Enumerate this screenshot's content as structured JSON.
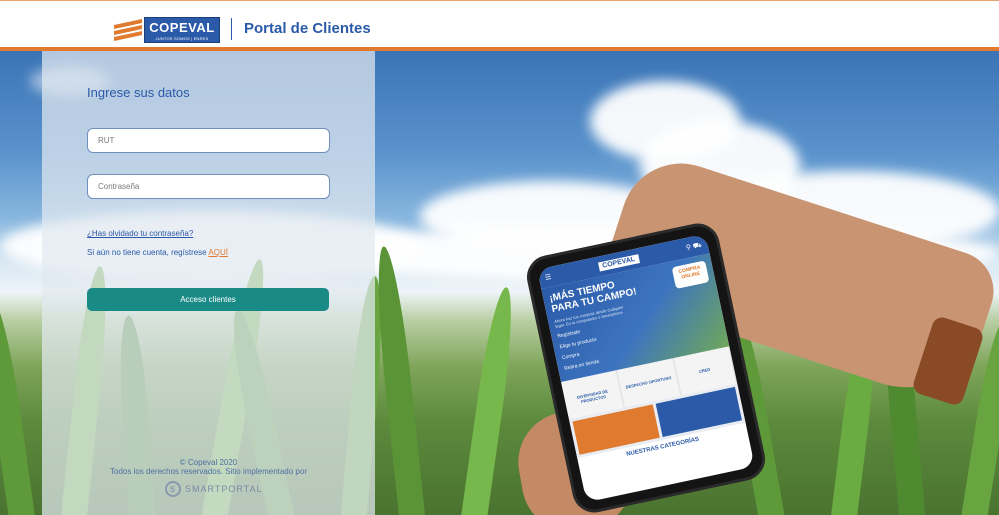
{
  "header": {
    "logo_text": "COPEVAL",
    "logo_tagline": "JUNTOS SOMOS | ENRES",
    "title": "Portal de Clientes"
  },
  "login": {
    "heading": "Ingrese sus datos",
    "rut_placeholder": "RUT",
    "password_placeholder": "Contraseña",
    "forgot_password": "¿Has olvidado tu contraseña?",
    "register_prefix": "Si aún no tiene cuenta, regístrese ",
    "register_link": "AQUÍ",
    "submit_label": "Acceso clientes"
  },
  "footer": {
    "copyright": "© Copeval 2020",
    "rights": "Todos los derechos reservados. Sitio implementado por",
    "provider": "SMARTPORTAL",
    "provider_icon": "smartportal-logo-icon"
  },
  "phone_screen": {
    "logo": "COPEVAL",
    "headline": "¡MÁS TIEMPO PARA TU CAMPO!",
    "subtext": "Ahora haz tus compras desde cualquier lugar. En tu computador o Smartphone",
    "badge": "COMPRA ONLINE",
    "steps": [
      "Regístrate",
      "Elige tu producto",
      "Compra",
      "Retira en tienda"
    ],
    "features": [
      "DIVERSIDAD DE PRODUCTOS",
      "DESPACHO OPORTUNO",
      "CRED"
    ],
    "categories_label": "NUESTRAS CATEGORÍAS"
  },
  "colors": {
    "brand_blue": "#2a5aa8",
    "accent_orange": "#e07a2f",
    "button_teal": "#1a8a87"
  }
}
